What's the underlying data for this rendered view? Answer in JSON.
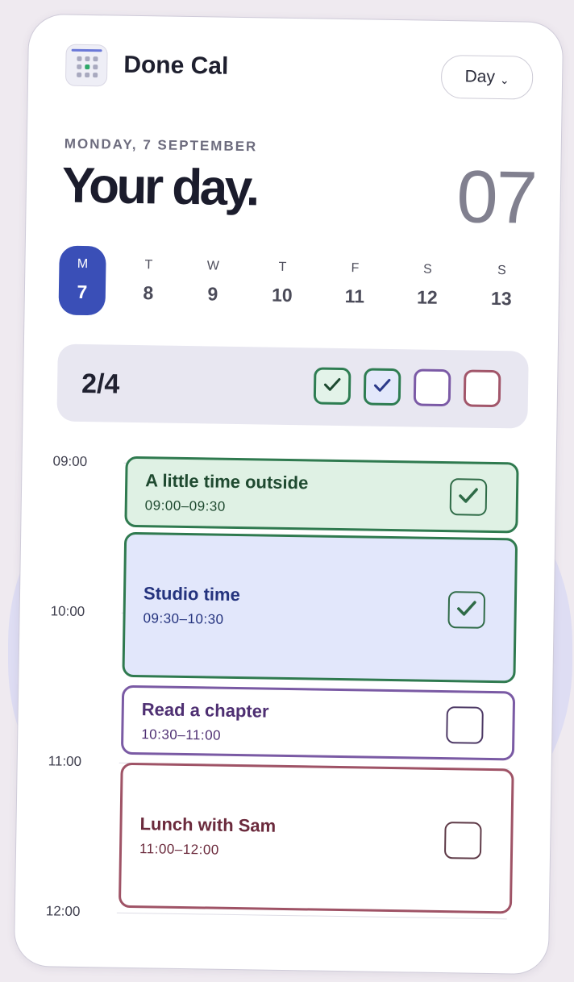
{
  "app": {
    "name": "Done Cal",
    "icon": "calendar-grid-icon"
  },
  "view_selector": {
    "label": "Day",
    "icon": "chevron-down-icon"
  },
  "today": {
    "date_label": "MONDAY, 7 SEPTEMBER",
    "headline": "Your day.",
    "day_number": "07"
  },
  "week": [
    {
      "letter": "M",
      "number": "7",
      "active": true
    },
    {
      "letter": "T",
      "number": "8"
    },
    {
      "letter": "W",
      "number": "9"
    },
    {
      "letter": "T",
      "number": "10"
    },
    {
      "letter": "F",
      "number": "11"
    },
    {
      "letter": "S",
      "number": "12"
    },
    {
      "letter": "S",
      "number": "13"
    }
  ],
  "progress": {
    "label": "2/4",
    "done": 2,
    "total": 4,
    "boxes": [
      {
        "checked": true,
        "border": "#2e7d52",
        "fill": "#e3f3e9",
        "mark": "#1d4a30"
      },
      {
        "checked": true,
        "border": "#2e7d52",
        "fill": "#e3e8fb",
        "mark": "#2b3a8a"
      },
      {
        "checked": false,
        "border": "#7b5aa6",
        "fill": "#ffffff"
      },
      {
        "checked": false,
        "border": "#a2566a",
        "fill": "#ffffff"
      }
    ]
  },
  "times": [
    "09:00",
    "10:00",
    "11:00",
    "12:00"
  ],
  "events": [
    {
      "title": "A little time outside",
      "time": "09:00–09:30",
      "done": true,
      "border": "#2f7a4f",
      "fill": "#dff1e4",
      "text": "#1f4a30",
      "check": "#2f6b47"
    },
    {
      "title": "Studio time",
      "time": "09:30–10:30",
      "done": true,
      "border": "#2f7a4f",
      "fill": "#e2e7fb",
      "text": "#24337e",
      "check": "#2f6b47"
    },
    {
      "title": "Read a chapter",
      "time": "10:30–11:00",
      "done": false,
      "border": "#7a5aa4",
      "fill": "#ffffff",
      "text": "#4e2f72",
      "check": "#4e3a66"
    },
    {
      "title": "Lunch with Sam",
      "time": "11:00–12:00",
      "done": false,
      "border": "#9f5366",
      "fill": "#ffffff",
      "text": "#6b2a3c",
      "check": "#5e3a47"
    }
  ]
}
